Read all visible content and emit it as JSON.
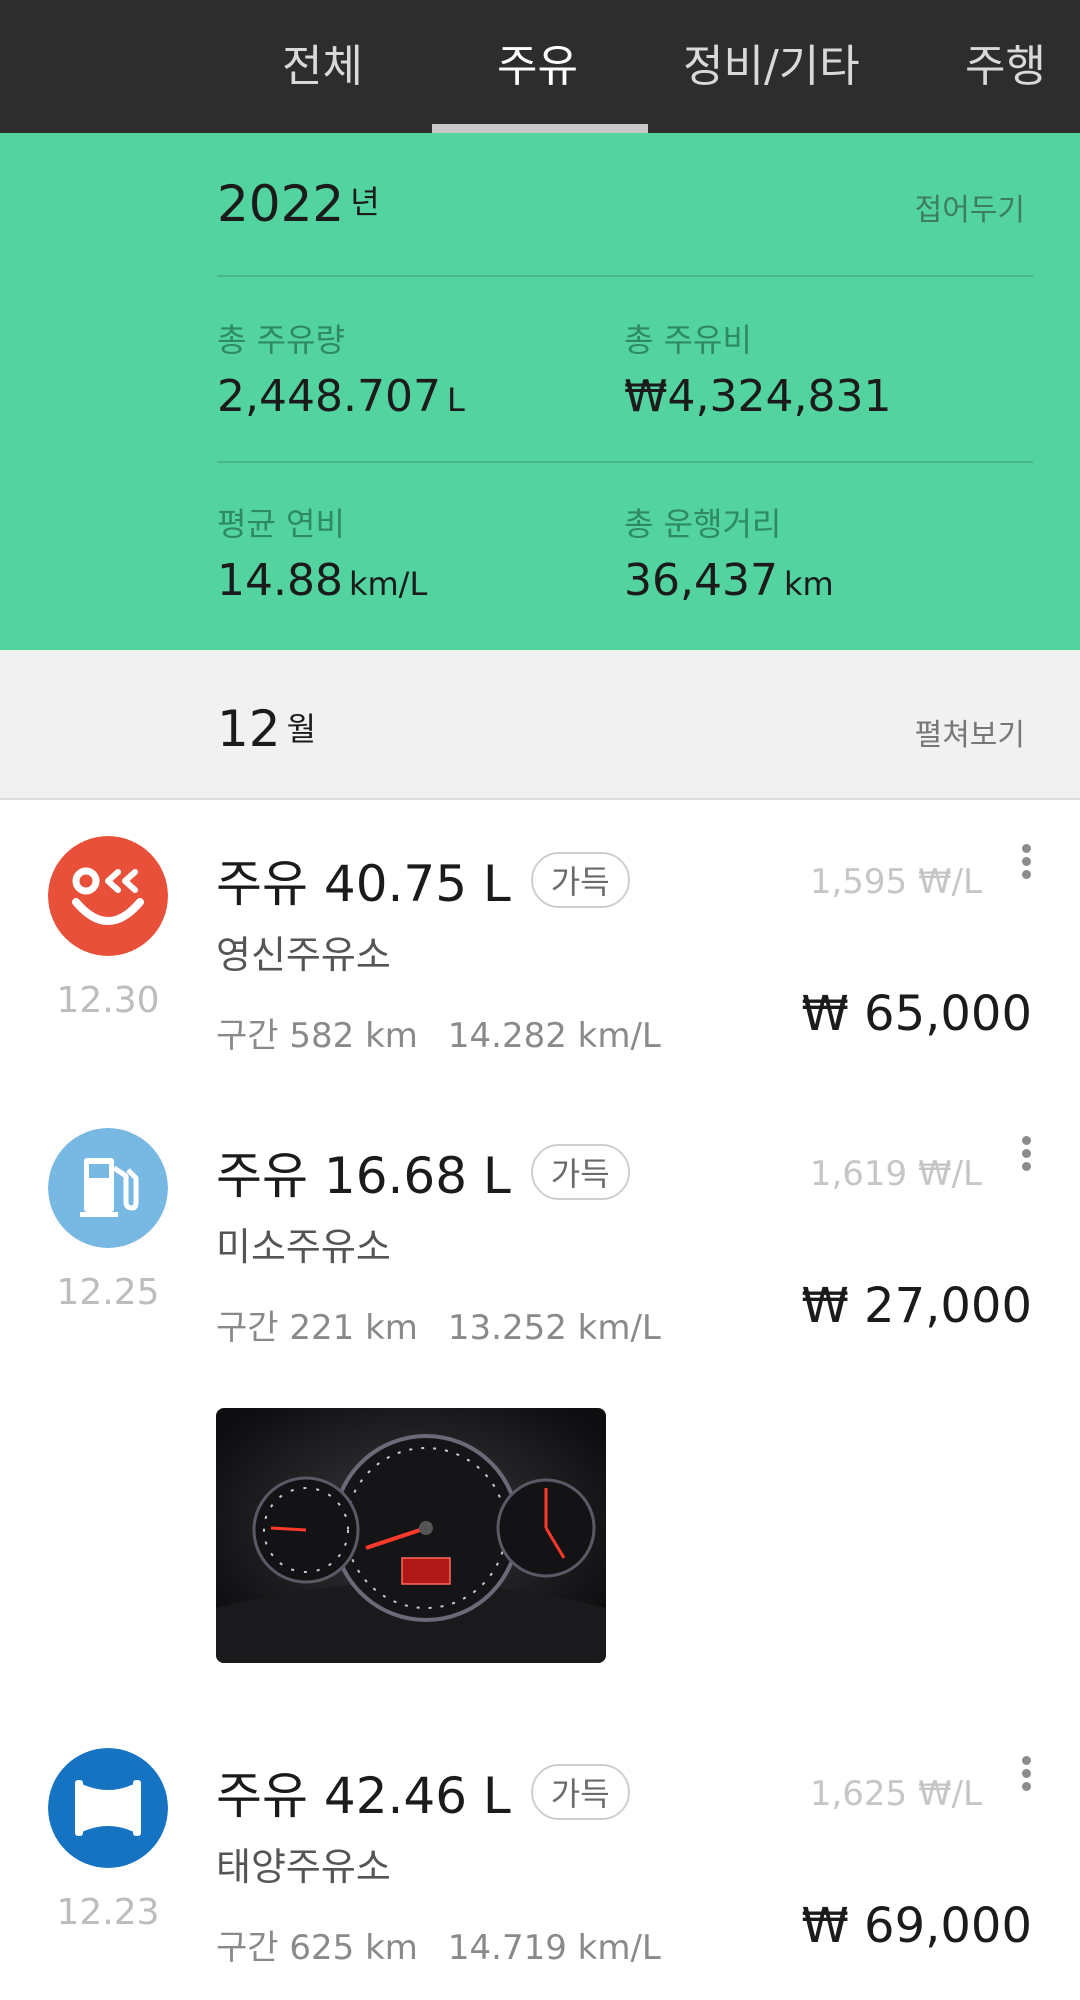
{
  "tabs": [
    {
      "label": "전체",
      "active": false
    },
    {
      "label": "주유",
      "active": true
    },
    {
      "label": "정비/기타",
      "active": false
    },
    {
      "label": "주행",
      "active": false
    }
  ],
  "summary": {
    "year": "2022",
    "year_unit": "년",
    "collapse_label": "접어두기",
    "stats": {
      "total_fuel": {
        "label": "총 주유량",
        "value": "2,448.707",
        "unit": "L"
      },
      "total_cost": {
        "label": "총 주유비",
        "value": "₩4,324,831",
        "unit": ""
      },
      "avg_efficiency": {
        "label": "평균 연비",
        "value": "14.88",
        "unit": "km/L"
      },
      "total_distance": {
        "label": "총 운행거리",
        "value": "36,437",
        "unit": "km"
      }
    }
  },
  "month": {
    "number": "12",
    "unit": "월",
    "expand_label": "펼쳐보기"
  },
  "entries": [
    {
      "title": "주유 40.75 L",
      "badge": "가득",
      "station": "영신주유소",
      "date": "12.30",
      "distance": "구간 582 km",
      "efficiency": "14.282 km/L",
      "unit_price": "1,595 ₩/L",
      "total": "₩ 65,000",
      "icon": "smile-brand-icon",
      "icon_color": "#e8503a"
    },
    {
      "title": "주유 16.68 L",
      "badge": "가득",
      "station": "미소주유소",
      "date": "12.25",
      "distance": "구간 221 km",
      "efficiency": "13.252 km/L",
      "unit_price": "1,619 ₩/L",
      "total": "₩ 27,000",
      "icon": "fuel-pump-icon",
      "icon_color": "#78b9e3"
    },
    {
      "title": "주유 42.46 L",
      "badge": "가득",
      "station": "태양주유소",
      "date": "12.23",
      "distance": "구간 625 km",
      "efficiency": "14.719 km/L",
      "unit_price": "1,625 ₩/L",
      "total": "₩ 69,000",
      "icon": "brand-logo-icon",
      "icon_color": "#1673c2"
    }
  ],
  "colors": {
    "tabbar": "#2d2d2d",
    "summary_bg": "#53d3a0",
    "month_bg": "#f1f1f1"
  }
}
